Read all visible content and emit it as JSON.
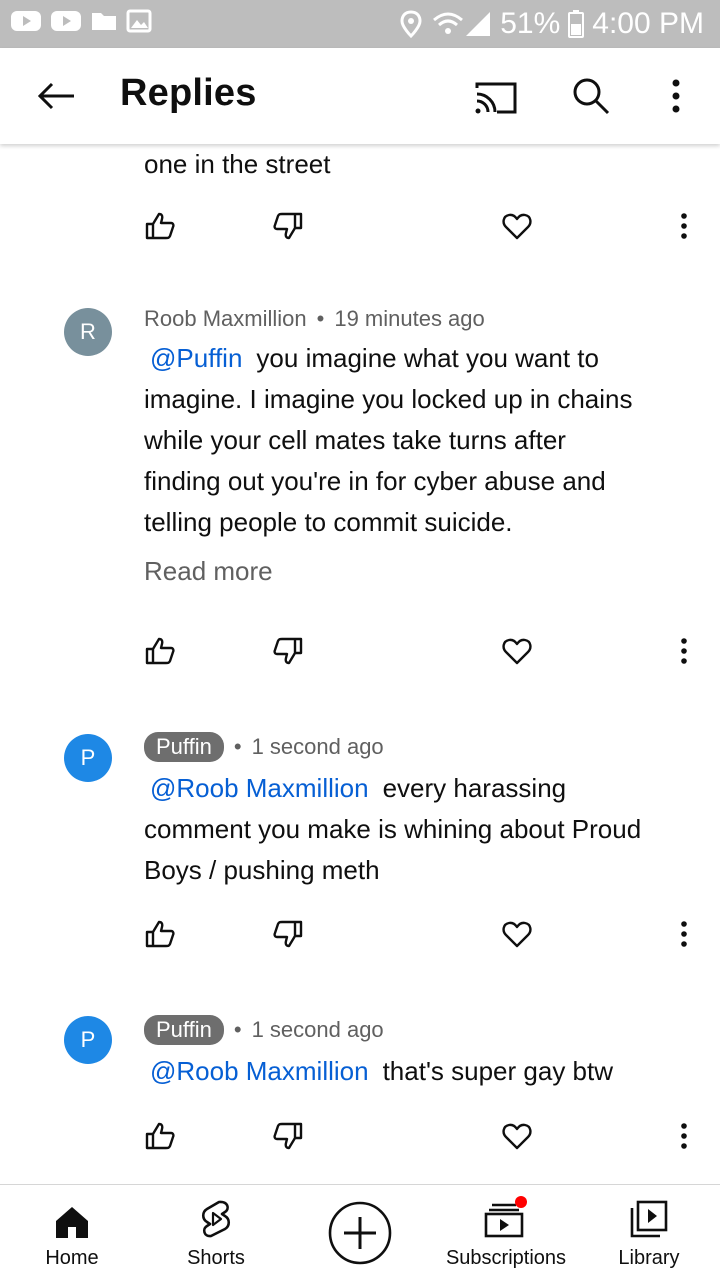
{
  "status_bar": {
    "battery": "51%",
    "time": "4:00 PM"
  },
  "app_bar": {
    "title": "Replies"
  },
  "partial_comment": {
    "text": "one in the street"
  },
  "comments": [
    {
      "avatar_letter": "R",
      "author": "Roob Maxmillion",
      "separator": "•",
      "time": "19 minutes ago",
      "mention": "@Puffin",
      "text_lines": [
        "you imagine what you want to",
        "imagine.  I imagine you locked up in chains",
        "while your cell mates take turns after",
        "finding out you're in for cyber abuse and",
        "telling people to commit suicide."
      ],
      "read_more": "Read more"
    },
    {
      "avatar_letter": "P",
      "author": "Puffin",
      "separator": "•",
      "time": "1 second ago",
      "mention": "@Roob Maxmillion",
      "text_lines": [
        "every harassing",
        "comment you make is whining about Proud",
        "Boys / pushing meth"
      ]
    },
    {
      "avatar_letter": "P",
      "author": "Puffin",
      "separator": "•",
      "time": "1 second ago",
      "mention": "@Roob Maxmillion",
      "text_lines": [
        "that's super gay btw"
      ]
    }
  ],
  "bottom_nav": {
    "home": "Home",
    "shorts": "Shorts",
    "subscriptions": "Subscriptions",
    "library": "Library"
  },
  "colors": {
    "status_bar_bg": "#bdbdbd",
    "mention": "#065fd4",
    "avatar_r": "#78909c",
    "avatar_p": "#1e88e5",
    "author_chip": "#6e6e6e",
    "notification_dot": "#ff0000"
  },
  "icons": {
    "app_bar": [
      "back-arrow-icon",
      "cast-icon",
      "search-icon",
      "more-vert-icon"
    ],
    "actions": [
      "thumb-up-icon",
      "thumb-down-icon",
      "heart-icon",
      "more-vert-icon"
    ],
    "nav": [
      "home-icon",
      "shorts-icon",
      "create-plus-icon",
      "subscriptions-icon",
      "library-icon"
    ]
  }
}
